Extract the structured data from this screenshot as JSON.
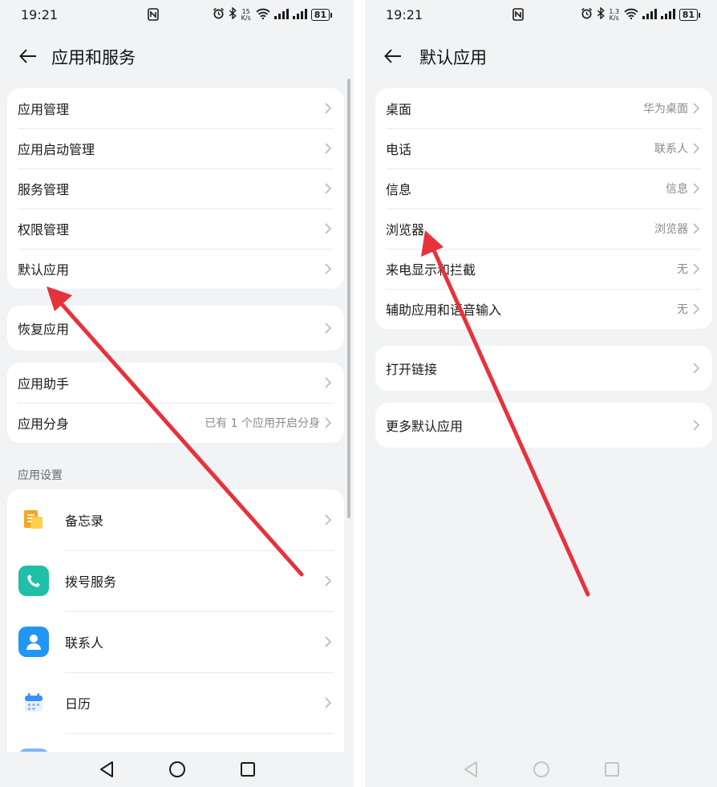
{
  "left_screen": {
    "status": {
      "time": "19:21",
      "speed_top": "15",
      "speed_bottom": "K/s",
      "battery": "81"
    },
    "title": "应用和服务",
    "group1": [
      {
        "label": "应用管理"
      },
      {
        "label": "应用启动管理"
      },
      {
        "label": "服务管理"
      },
      {
        "label": "权限管理"
      },
      {
        "label": "默认应用"
      }
    ],
    "group2": [
      {
        "label": "恢复应用"
      }
    ],
    "group3": [
      {
        "label": "应用助手",
        "value": ""
      },
      {
        "label": "应用分身",
        "value": "已有 1 个应用开启分身"
      }
    ],
    "section_header": "应用设置",
    "apps": [
      {
        "label": "备忘录",
        "icon": "memo-icon",
        "color": "#f5a623"
      },
      {
        "label": "拨号服务",
        "icon": "phone-icon",
        "color": "#1fbfa8"
      },
      {
        "label": "联系人",
        "icon": "contacts-icon",
        "color": "#2196f3"
      },
      {
        "label": "日历",
        "icon": "calendar-icon",
        "color": "#3d8ff5"
      }
    ]
  },
  "right_screen": {
    "status": {
      "time": "19:21",
      "speed_top": "1.3",
      "speed_bottom": "K/s",
      "battery": "81"
    },
    "title": "默认应用",
    "group1": [
      {
        "label": "桌面",
        "value": "华为桌面"
      },
      {
        "label": "电话",
        "value": "联系人"
      },
      {
        "label": "信息",
        "value": "信息"
      },
      {
        "label": "浏览器",
        "value": "浏览器"
      },
      {
        "label": "来电显示和拦截",
        "value": "无"
      },
      {
        "label": "辅助应用和语音输入",
        "value": "无"
      }
    ],
    "group2": [
      {
        "label": "打开链接"
      }
    ],
    "group3": [
      {
        "label": "更多默认应用"
      }
    ]
  },
  "colors": {
    "annotation_arrow": "#e8313b",
    "background": "#f1f3f5",
    "card": "#ffffff"
  }
}
